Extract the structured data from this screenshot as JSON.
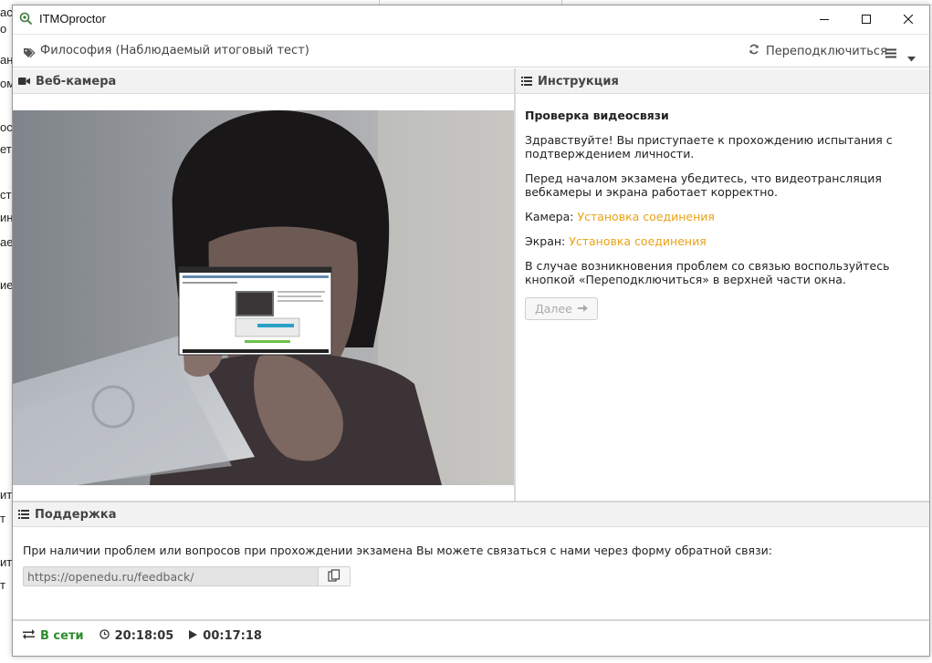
{
  "window": {
    "app_title": "ITMOproctor"
  },
  "toolbar": {
    "exam_title": "Философия (Наблюдаемый итоговый тест)",
    "reconnect_label": "Переподключиться"
  },
  "webcam": {
    "header": "Веб-камера"
  },
  "instructions": {
    "header": "Инструкция",
    "heading": "Проверка видеосвязи",
    "greeting": "Здравствуйте! Вы приступаете к прохождению испытания с подтверждением личности.",
    "check_text": "Перед началом экзамена убедитесь, что видеотрансляция вебкамеры и экрана работает корректно.",
    "camera_label": "Камера:",
    "camera_status": "Установка соединения",
    "screen_label": "Экран:",
    "screen_status": "Установка соединения",
    "trouble_text": "В случае возникновения проблем со связью воспользуйтесь кнопкой «Переподключиться» в верхней части окна.",
    "next_label": "Далее"
  },
  "support": {
    "header": "Поддержка",
    "text": "При наличии проблем или вопросов при прохождении экзамена Вы можете связаться с нами через форму обратной связи:",
    "feedback_url": "https://openedu.ru/feedback/"
  },
  "status": {
    "online": "В сети",
    "clock": "20:18:05",
    "elapsed": "00:17:18"
  },
  "background_fragments": [
    "ас",
    "о",
    "ан",
    "ом",
    "ос",
    "ете",
    "ст",
    "ин",
    "ает",
    "ие",
    "ит",
    "т",
    "ит",
    "т"
  ],
  "colors": {
    "accent_link": "#e8a317",
    "online": "#2e8b2e"
  }
}
